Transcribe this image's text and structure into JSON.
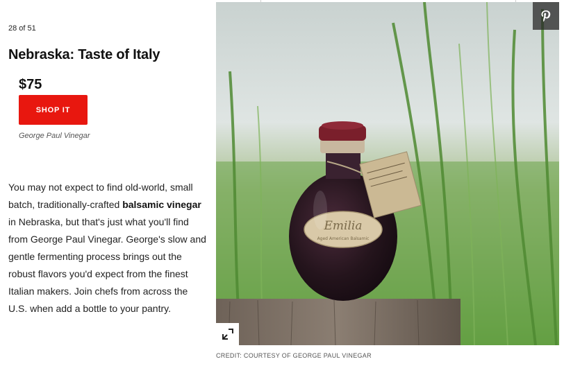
{
  "slide": {
    "counter": "28 of 51",
    "title": "Nebraska: Taste of Italy",
    "price": "$75",
    "shop_label": "SHOP IT",
    "brand": "George Paul Vinegar"
  },
  "description": {
    "part1": "You may not expect to find old-world, small batch, traditionally-crafted ",
    "bold": "balsamic vinegar",
    "part2": " in Nebraska, but that's just what you'll find from George Paul Vinegar. George's slow and gentle fermenting process brings out the robust flavors you'd expect from the finest Italian makers. Join chefs from across the U.S. when add a bottle to your pantry."
  },
  "photo": {
    "label_script": "Emilia",
    "label_sub": "Aged American Balsamic",
    "credit": "CREDIT: COURTESY OF GEORGE PAUL VINEGAR"
  },
  "icons": {
    "pin": "pinterest-icon",
    "expand": "expand-icon"
  },
  "colors": {
    "shop_button": "#e8170f",
    "pin_bg": "#333333",
    "grass": "#6fa24a",
    "wax": "#7a1f2b",
    "liquid": "#2a1a22"
  }
}
